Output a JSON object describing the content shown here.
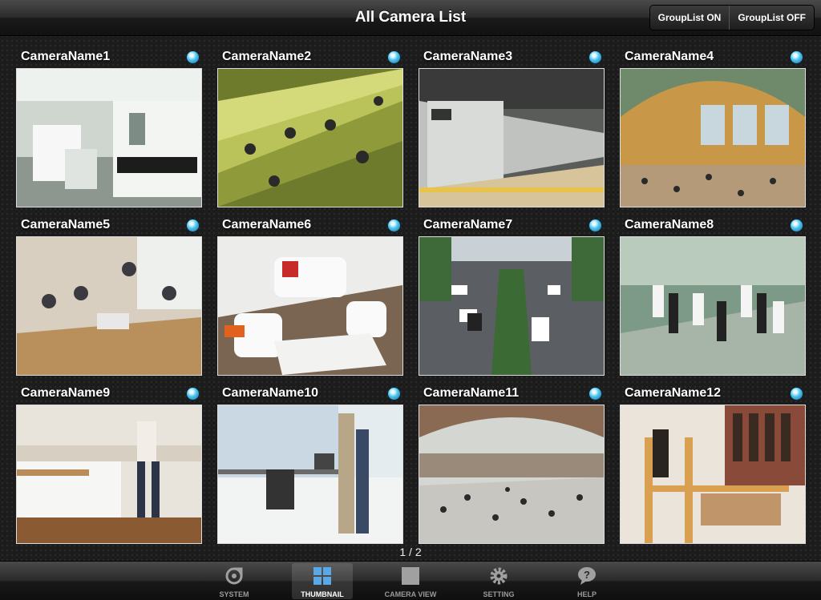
{
  "header": {
    "title": "All Camera List",
    "group_on_label": "GroupList ON",
    "group_off_label": "GroupList OFF"
  },
  "cameras": [
    {
      "name": "CameraName1",
      "scene": "laboratory"
    },
    {
      "name": "CameraName2",
      "scene": "escalator-crowd"
    },
    {
      "name": "CameraName3",
      "scene": "subway-train"
    },
    {
      "name": "CameraName4",
      "scene": "station-hall"
    },
    {
      "name": "CameraName5",
      "scene": "meeting-room"
    },
    {
      "name": "CameraName6",
      "scene": "living-room"
    },
    {
      "name": "CameraName7",
      "scene": "city-traffic"
    },
    {
      "name": "CameraName8",
      "scene": "stairs-crowd"
    },
    {
      "name": "CameraName9",
      "scene": "kitchen"
    },
    {
      "name": "CameraName10",
      "scene": "office"
    },
    {
      "name": "CameraName11",
      "scene": "airport-concourse"
    },
    {
      "name": "CameraName12",
      "scene": "clothing-store"
    }
  ],
  "pagination": {
    "current": 1,
    "total": 2,
    "text": "1 / 2"
  },
  "tabs": [
    {
      "label": "SYSTEM",
      "icon": "system-icon",
      "active": false
    },
    {
      "label": "THUMBNAIL",
      "icon": "grid-icon",
      "active": true
    },
    {
      "label": "CAMERA VIEW",
      "icon": "camera-view-icon",
      "active": false
    },
    {
      "label": "SETTING",
      "icon": "gear-icon",
      "active": false
    },
    {
      "label": "HELP",
      "icon": "help-icon",
      "active": false
    }
  ],
  "colors": {
    "status_dot": "#4bc4ef",
    "active_tab_label": "#ffffff"
  }
}
